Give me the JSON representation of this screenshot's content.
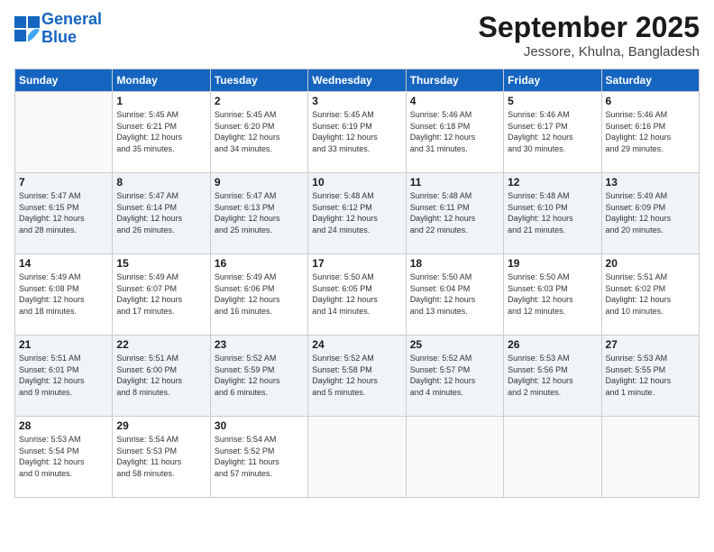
{
  "logo": {
    "line1": "General",
    "line2": "Blue"
  },
  "title": "September 2025",
  "location": "Jessore, Khulna, Bangladesh",
  "days_of_week": [
    "Sunday",
    "Monday",
    "Tuesday",
    "Wednesday",
    "Thursday",
    "Friday",
    "Saturday"
  ],
  "weeks": [
    [
      {
        "day": "",
        "info": ""
      },
      {
        "day": "1",
        "info": "Sunrise: 5:45 AM\nSunset: 6:21 PM\nDaylight: 12 hours\nand 35 minutes."
      },
      {
        "day": "2",
        "info": "Sunrise: 5:45 AM\nSunset: 6:20 PM\nDaylight: 12 hours\nand 34 minutes."
      },
      {
        "day": "3",
        "info": "Sunrise: 5:45 AM\nSunset: 6:19 PM\nDaylight: 12 hours\nand 33 minutes."
      },
      {
        "day": "4",
        "info": "Sunrise: 5:46 AM\nSunset: 6:18 PM\nDaylight: 12 hours\nand 31 minutes."
      },
      {
        "day": "5",
        "info": "Sunrise: 5:46 AM\nSunset: 6:17 PM\nDaylight: 12 hours\nand 30 minutes."
      },
      {
        "day": "6",
        "info": "Sunrise: 5:46 AM\nSunset: 6:16 PM\nDaylight: 12 hours\nand 29 minutes."
      }
    ],
    [
      {
        "day": "7",
        "info": "Sunrise: 5:47 AM\nSunset: 6:15 PM\nDaylight: 12 hours\nand 28 minutes."
      },
      {
        "day": "8",
        "info": "Sunrise: 5:47 AM\nSunset: 6:14 PM\nDaylight: 12 hours\nand 26 minutes."
      },
      {
        "day": "9",
        "info": "Sunrise: 5:47 AM\nSunset: 6:13 PM\nDaylight: 12 hours\nand 25 minutes."
      },
      {
        "day": "10",
        "info": "Sunrise: 5:48 AM\nSunset: 6:12 PM\nDaylight: 12 hours\nand 24 minutes."
      },
      {
        "day": "11",
        "info": "Sunrise: 5:48 AM\nSunset: 6:11 PM\nDaylight: 12 hours\nand 22 minutes."
      },
      {
        "day": "12",
        "info": "Sunrise: 5:48 AM\nSunset: 6:10 PM\nDaylight: 12 hours\nand 21 minutes."
      },
      {
        "day": "13",
        "info": "Sunrise: 5:49 AM\nSunset: 6:09 PM\nDaylight: 12 hours\nand 20 minutes."
      }
    ],
    [
      {
        "day": "14",
        "info": "Sunrise: 5:49 AM\nSunset: 6:08 PM\nDaylight: 12 hours\nand 18 minutes."
      },
      {
        "day": "15",
        "info": "Sunrise: 5:49 AM\nSunset: 6:07 PM\nDaylight: 12 hours\nand 17 minutes."
      },
      {
        "day": "16",
        "info": "Sunrise: 5:49 AM\nSunset: 6:06 PM\nDaylight: 12 hours\nand 16 minutes."
      },
      {
        "day": "17",
        "info": "Sunrise: 5:50 AM\nSunset: 6:05 PM\nDaylight: 12 hours\nand 14 minutes."
      },
      {
        "day": "18",
        "info": "Sunrise: 5:50 AM\nSunset: 6:04 PM\nDaylight: 12 hours\nand 13 minutes."
      },
      {
        "day": "19",
        "info": "Sunrise: 5:50 AM\nSunset: 6:03 PM\nDaylight: 12 hours\nand 12 minutes."
      },
      {
        "day": "20",
        "info": "Sunrise: 5:51 AM\nSunset: 6:02 PM\nDaylight: 12 hours\nand 10 minutes."
      }
    ],
    [
      {
        "day": "21",
        "info": "Sunrise: 5:51 AM\nSunset: 6:01 PM\nDaylight: 12 hours\nand 9 minutes."
      },
      {
        "day": "22",
        "info": "Sunrise: 5:51 AM\nSunset: 6:00 PM\nDaylight: 12 hours\nand 8 minutes."
      },
      {
        "day": "23",
        "info": "Sunrise: 5:52 AM\nSunset: 5:59 PM\nDaylight: 12 hours\nand 6 minutes."
      },
      {
        "day": "24",
        "info": "Sunrise: 5:52 AM\nSunset: 5:58 PM\nDaylight: 12 hours\nand 5 minutes."
      },
      {
        "day": "25",
        "info": "Sunrise: 5:52 AM\nSunset: 5:57 PM\nDaylight: 12 hours\nand 4 minutes."
      },
      {
        "day": "26",
        "info": "Sunrise: 5:53 AM\nSunset: 5:56 PM\nDaylight: 12 hours\nand 2 minutes."
      },
      {
        "day": "27",
        "info": "Sunrise: 5:53 AM\nSunset: 5:55 PM\nDaylight: 12 hours\nand 1 minute."
      }
    ],
    [
      {
        "day": "28",
        "info": "Sunrise: 5:53 AM\nSunset: 5:54 PM\nDaylight: 12 hours\nand 0 minutes."
      },
      {
        "day": "29",
        "info": "Sunrise: 5:54 AM\nSunset: 5:53 PM\nDaylight: 11 hours\nand 58 minutes."
      },
      {
        "day": "30",
        "info": "Sunrise: 5:54 AM\nSunset: 5:52 PM\nDaylight: 11 hours\nand 57 minutes."
      },
      {
        "day": "",
        "info": ""
      },
      {
        "day": "",
        "info": ""
      },
      {
        "day": "",
        "info": ""
      },
      {
        "day": "",
        "info": ""
      }
    ]
  ]
}
